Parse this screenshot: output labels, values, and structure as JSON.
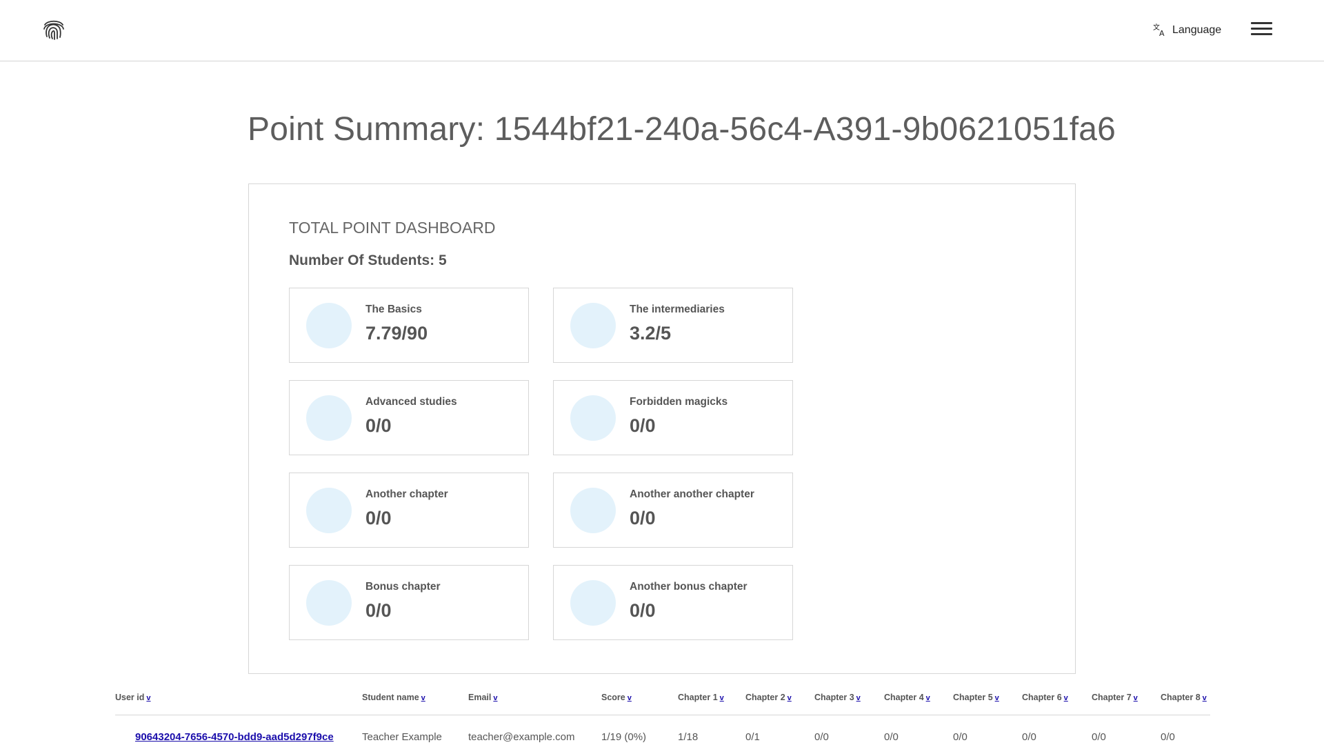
{
  "header": {
    "logo_icon": "fingerprint-icon",
    "language_icon": "translate-icon",
    "language_label": "Language",
    "menu_icon": "hamburger-menu-icon"
  },
  "page": {
    "title": "Point Summary: 1544bf21-240a-56c4-A391-9b0621051fa6"
  },
  "dashboard": {
    "title": "TOTAL POINT DASHBOARD",
    "students": "Number Of Students: 5",
    "cards": [
      {
        "label": "The Basics",
        "value": "7.79/90"
      },
      {
        "label": "The intermediaries",
        "value": "3.2/5"
      },
      {
        "label": "Advanced studies",
        "value": "0/0"
      },
      {
        "label": "Forbidden magicks",
        "value": "0/0"
      },
      {
        "label": "Another chapter",
        "value": "0/0"
      },
      {
        "label": "Another another chapter",
        "value": "0/0"
      },
      {
        "label": "Bonus chapter",
        "value": "0/0"
      },
      {
        "label": "Another bonus chapter",
        "value": "0/0"
      }
    ]
  },
  "table": {
    "sort_glyph": "v",
    "columns": [
      "User id",
      "Student name",
      "Email",
      "Score",
      "Chapter 1",
      "Chapter 2",
      "Chapter 3",
      "Chapter 4",
      "Chapter 5",
      "Chapter 6",
      "Chapter 7",
      "Chapter 8"
    ],
    "rows": [
      [
        "90643204-7656-4570-bdd9-aad5d297f9ce",
        "Teacher Example",
        "teacher@example.com",
        "1/19 (0%)",
        "1/18",
        "0/1",
        "0/0",
        "0/0",
        "0/0",
        "0/0",
        "0/0",
        "0/0"
      ]
    ]
  },
  "colors": {
    "accent_circle": "#e3f2fb",
    "link": "#1a0dab",
    "border": "#d6d6d6"
  }
}
